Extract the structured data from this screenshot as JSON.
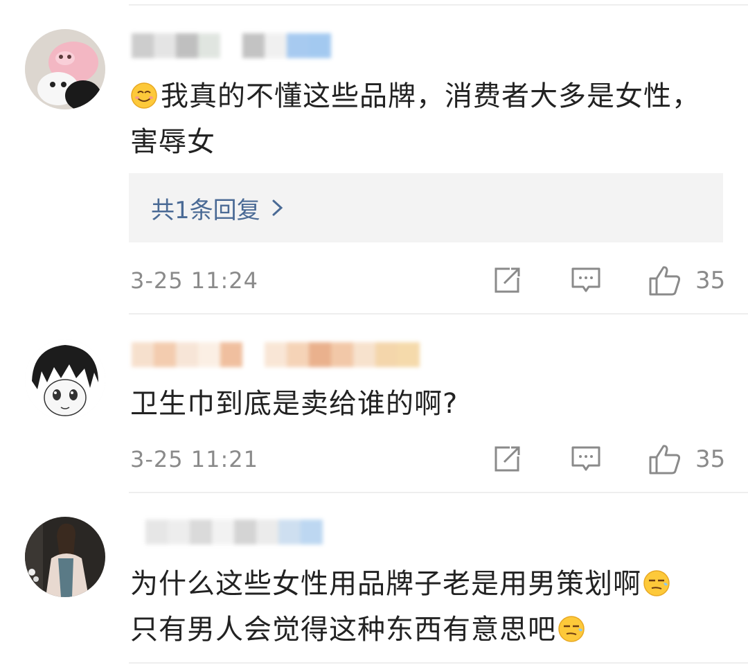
{
  "comments": [
    {
      "text": "我真的不懂这些品牌，消费者大多是女性，害辱女",
      "leading_emoji": "smiling-face",
      "reply_link": "共1条回复",
      "timestamp": "3-25 11:24",
      "likes": "35"
    },
    {
      "text": "卫生巾到底是卖给谁的啊?",
      "timestamp": "3-25 11:21",
      "likes": "35"
    },
    {
      "line1": "为什么这些女性用品牌子老是用男策划啊",
      "line2": "只有男人会觉得这种东西有意思吧",
      "trailing_emoji": "smirk-face"
    }
  ],
  "colors": {
    "link": "#4a6a95",
    "meta": "#8a8a8a",
    "reply_bg": "#f3f3f3"
  }
}
